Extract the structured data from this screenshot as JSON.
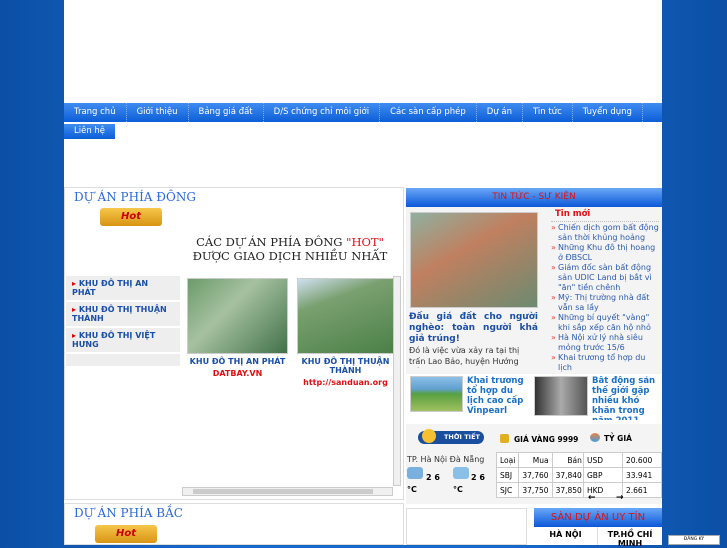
{
  "nav": {
    "items": [
      "Trang chủ",
      "Giới thiệu",
      "Bảng giá đất",
      "D/S chứng chỉ môi giới",
      "Các sàn cấp phép",
      "Dự án",
      "Tin tức",
      "Tuyển dụng"
    ],
    "second": "Liên hệ"
  },
  "east": {
    "title": "DỰ ÁN PHÍA ĐÔNG",
    "hot": "Hot",
    "headline1": "CÁC DỰ ÁN PHÍA ĐÔNG ",
    "headline_hot": "\"HOT\"",
    "headline2": "ĐƯỢC GIAO DỊCH NHIỀU NHẤT",
    "menu": [
      "KHU ĐÔ THỊ AN PHÁT",
      "KHU ĐÔ THỊ THUẬN THÀNH",
      "KHU ĐÔ THỊ VIỆT HƯNG"
    ],
    "projects": [
      {
        "name": "KHU ĐÔ THỊ AN PHÁT",
        "link": "DATBAY.VN"
      },
      {
        "name": "KHU ĐÔ THỊ THUẬN THÀNH",
        "link": "http://sanduan.org"
      }
    ]
  },
  "north": {
    "title": "DỰ ÁN PHÍA BẮC",
    "hot": "Hot"
  },
  "news": {
    "title": "TIN TỨC - SỰ KIỆN",
    "latest_label": "Tin mới",
    "featured_title": "Đấu giá đất cho người nghèo: toàn người khá giả trúng!",
    "featured_summary": "Đó là việc vừa xảy ra tại thị trấn Lao Bảo, huyện Hướng Hóa,",
    "latest": [
      "Chiến dịch gom bất động sản thời khủng hoảng",
      "Những Khu đô thị hoang ở ĐBSCL",
      "Giám đốc sàn bất động sản UDIC Land bị bắt vì \"ăn\" tiền chênh",
      "Mỹ: Thị trường nhà đất vẫn sa lầy",
      "Những bí quyết \"vàng\" khi sắp xếp căn hộ nhỏ",
      "Hà Nội xử lý nhà siêu mỏng trước 15/6",
      "Khai trương tổ hợp du lịch"
    ],
    "cards": [
      "Khai trương tổ hợp du lịch cao cấp Vinpearl",
      "Bất động sản thế giới gặp nhiều khó khăn trong năm 2011"
    ]
  },
  "weather": {
    "label": "THỜI TIẾT",
    "cities": "TP. Hà Nội Đà Nẵng",
    "temps": [
      "2 6",
      "2 6"
    ],
    "unit": "°C"
  },
  "gold": {
    "label": "GIÁ VÀNG 9999",
    "headers": [
      "Loại",
      "Mua",
      "Bán"
    ],
    "rows": [
      [
        "SBJ",
        "37,760",
        "37,840"
      ],
      [
        "SJC",
        "37,750",
        "37,850"
      ]
    ]
  },
  "fx": {
    "label": "TỶ GIÁ",
    "rows": [
      [
        "USD",
        "20.600"
      ],
      [
        "GBP",
        "33.941"
      ],
      [
        "HKD",
        "2.661"
      ]
    ],
    "prev": "←",
    "next": "→"
  },
  "exchanges": {
    "title": "SÀN DỰ ÁN UY TÍN",
    "cols": [
      "HÀ NỘI",
      "TP.HỒ CHÍ MINH"
    ]
  },
  "ad": {
    "label": "ĐĂNG KÝ"
  }
}
